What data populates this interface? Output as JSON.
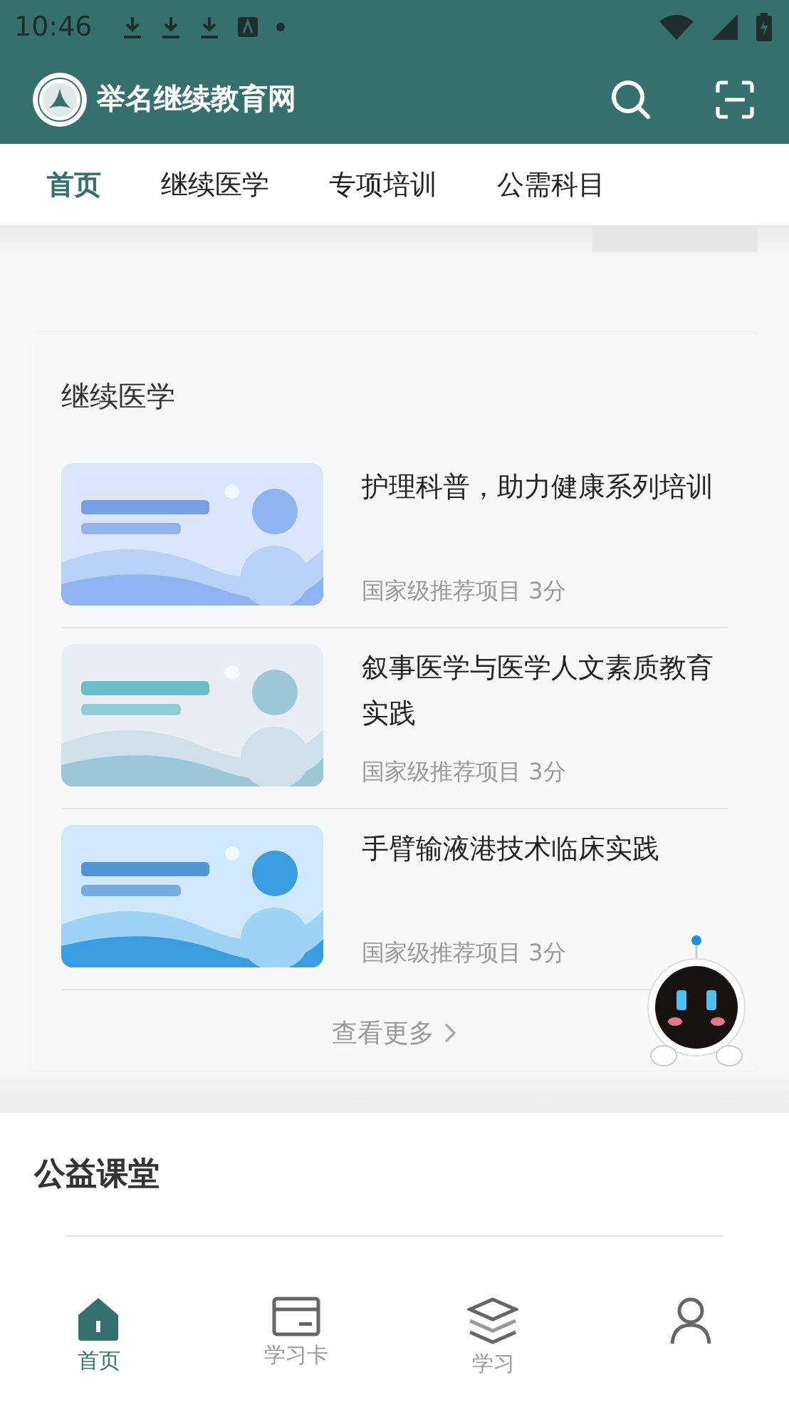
{
  "status_bar": {
    "time": "10:46"
  },
  "header": {
    "site_name": "举名继续教育网"
  },
  "tabs": [
    {
      "label": "首页",
      "selected": true
    },
    {
      "label": "继续医学",
      "selected": false
    },
    {
      "label": "专项培训",
      "selected": false
    },
    {
      "label": "公需科目",
      "selected": false
    }
  ],
  "course_card": {
    "title": "继续医学",
    "courses": [
      {
        "title": "护理科普，助力健康系列培训",
        "meta": "国家级推荐项目 3分",
        "kind": "picture"
      },
      {
        "title": "叙事医学与医学人文素质教育实践",
        "meta": "国家级推荐项目 3分",
        "kind": "picture"
      },
      {
        "title": "手臂输液港技术临床实践",
        "meta": "国家级推荐项目 3分",
        "kind": "picture"
      }
    ],
    "more": "查看更多"
  },
  "public_section": {
    "title": "公益课堂"
  },
  "bottom_nav": [
    {
      "label": "首页",
      "kind": "home",
      "selected": true
    },
    {
      "label": "学习卡",
      "kind": "card",
      "selected": false
    },
    {
      "label": "学习",
      "kind": "layers",
      "selected": false
    },
    {
      "kind": "person",
      "selected": false
    }
  ]
}
